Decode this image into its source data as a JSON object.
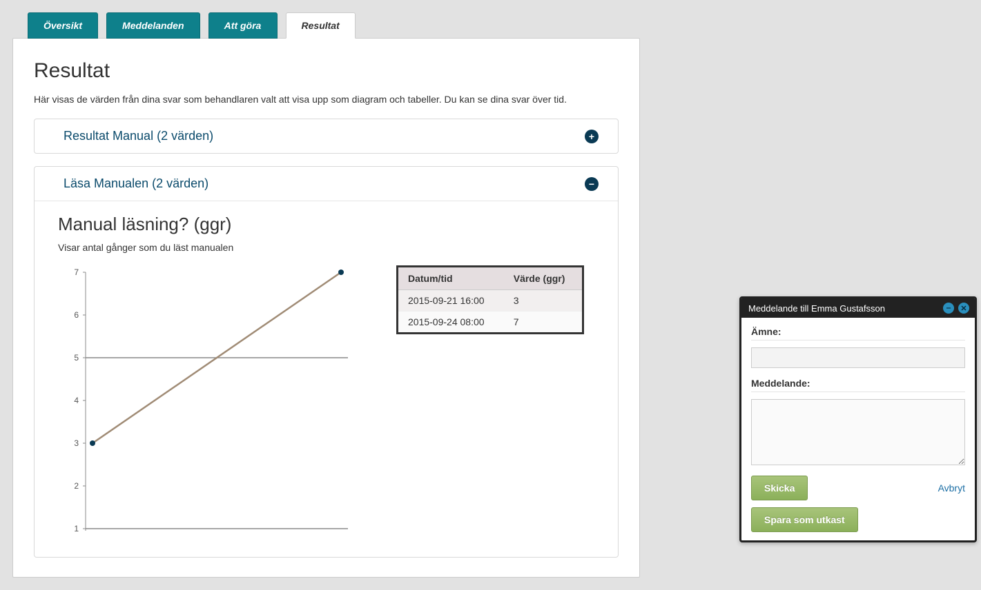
{
  "tabs": {
    "oversikt": "Översikt",
    "meddelanden": "Meddelanden",
    "att_gora": "Att göra",
    "resultat": "Resultat"
  },
  "page_title": "Resultat",
  "page_desc": "Här visas de värden från dina svar som behandlaren valt att visa upp som diagram och tabeller. Du kan se dina svar över tid.",
  "panel1_title": "Resultat Manual (2 värden)",
  "panel2": {
    "title": "Läsa Manualen (2 värden)",
    "chart_title": "Manual läsning? (ggr)",
    "chart_subtitle": "Visar antal gånger som du läst manualen",
    "table": {
      "head_date": "Datum/tid",
      "head_value": "Värde (ggr)",
      "rows": [
        {
          "date": "2015-09-21 16:00",
          "value": "3"
        },
        {
          "date": "2015-09-24 08:00",
          "value": "7"
        }
      ]
    }
  },
  "chart_data": {
    "type": "line",
    "title": "Manual läsning? (ggr)",
    "subtitle": "Visar antal gånger som du läst manualen",
    "xlabel": "",
    "ylabel": "",
    "ylim": [
      1,
      7
    ],
    "y_ticks": [
      1,
      2,
      3,
      4,
      5,
      6,
      7
    ],
    "reference_line": 5,
    "categories": [
      "2015-09-21 16:00",
      "2015-09-24 08:00"
    ],
    "series": [
      {
        "name": "Värde (ggr)",
        "values": [
          3,
          7
        ]
      }
    ]
  },
  "dialog": {
    "title": "Meddelande till Emma Gustafsson",
    "subject_label": "Ämne:",
    "message_label": "Meddelande:",
    "send": "Skicka",
    "cancel": "Avbryt",
    "save_draft": "Spara som utkast"
  }
}
